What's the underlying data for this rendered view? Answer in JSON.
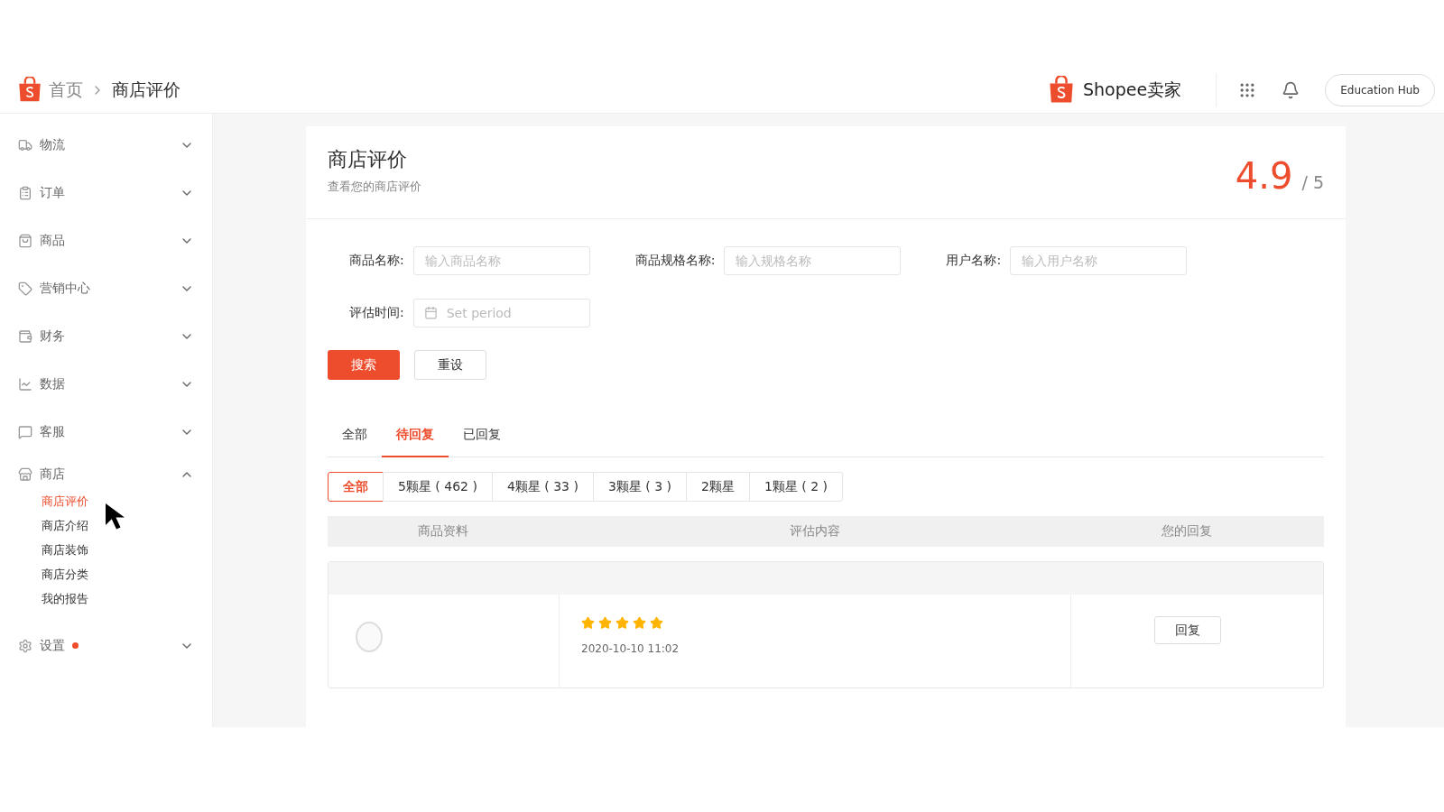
{
  "header": {
    "breadcrumb": [
      "首页",
      "商店评价"
    ],
    "brand": "Shopee卖家",
    "hub_button": "Education Hub"
  },
  "sidebar": {
    "items": [
      {
        "label": "物流",
        "expanded": false
      },
      {
        "label": "订单",
        "expanded": false
      },
      {
        "label": "商品",
        "expanded": false
      },
      {
        "label": "营销中心",
        "expanded": false
      },
      {
        "label": "财务",
        "expanded": false
      },
      {
        "label": "数据",
        "expanded": false
      },
      {
        "label": "客服",
        "expanded": false
      },
      {
        "label": "商店",
        "expanded": true,
        "children": [
          {
            "label": "商店评价",
            "selected": true
          },
          {
            "label": "商店介绍",
            "selected": false
          },
          {
            "label": "商店装饰",
            "selected": false
          },
          {
            "label": "商店分类",
            "selected": false
          },
          {
            "label": "我的报告",
            "selected": false
          }
        ]
      },
      {
        "label": "设置",
        "expanded": false,
        "notification": true
      }
    ]
  },
  "page": {
    "title": "商店评价",
    "subtitle": "查看您的商店评价",
    "rating": "4.9",
    "rating_max": "/ 5"
  },
  "filters": [
    {
      "label": "商品名称:",
      "placeholder": "输入商品名称",
      "kind": "text"
    },
    {
      "label": "商品规格名称:",
      "placeholder": "输入规格名称",
      "kind": "text"
    },
    {
      "label": "用户名称:",
      "placeholder": "输入用户名称",
      "kind": "text"
    },
    {
      "label": "评估时间:",
      "placeholder": "Set period",
      "kind": "date"
    }
  ],
  "buttons": {
    "search": "搜索",
    "reset": "重设"
  },
  "tabs": [
    {
      "label": "全部",
      "selected": false
    },
    {
      "label": "待回复",
      "selected": true
    },
    {
      "label": "已回复",
      "selected": false
    }
  ],
  "star_filters": [
    {
      "label": "全部",
      "selected": true
    },
    {
      "label": "5颗星 ( 462 )",
      "selected": false
    },
    {
      "label": "4颗星 ( 33 )",
      "selected": false
    },
    {
      "label": "3颗星 ( 3 )",
      "selected": false
    },
    {
      "label": "2颗星",
      "selected": false
    },
    {
      "label": "1颗星 ( 2 )",
      "selected": false
    }
  ],
  "table": {
    "columns": [
      "商品资料",
      "评估内容",
      "您的回复"
    ],
    "rows": [
      {
        "stars": 5,
        "date": "2020-10-10 11:02",
        "reply_button": "回复"
      }
    ]
  }
}
